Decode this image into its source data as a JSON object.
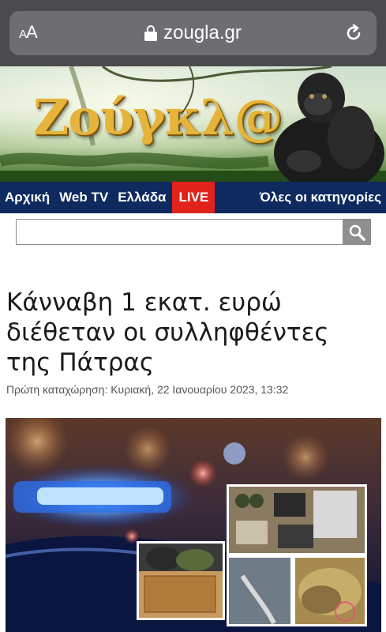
{
  "browser": {
    "text_size_label": "AA",
    "url": "zougla.gr"
  },
  "site": {
    "logo_text": "Ζούγκλ@"
  },
  "nav": {
    "items": [
      "Αρχική",
      "Web TV",
      "Ελλάδα"
    ],
    "live": "LIVE",
    "all_categories": "Όλες οι κατηγορίες"
  },
  "search": {
    "value": ""
  },
  "article": {
    "headline": "Κάνναβη 1 εκατ. ευρώ διέθεταν οι συλληφθέντες της Πάτρας",
    "meta": "Πρώτη καταχώρηση: Κυριακή, 22 Ιανουαρίου 2023, 13:32"
  },
  "colors": {
    "nav_background": "#0e2a5f",
    "live_badge": "#e0231b",
    "logo_gold": "#e6b43a"
  }
}
